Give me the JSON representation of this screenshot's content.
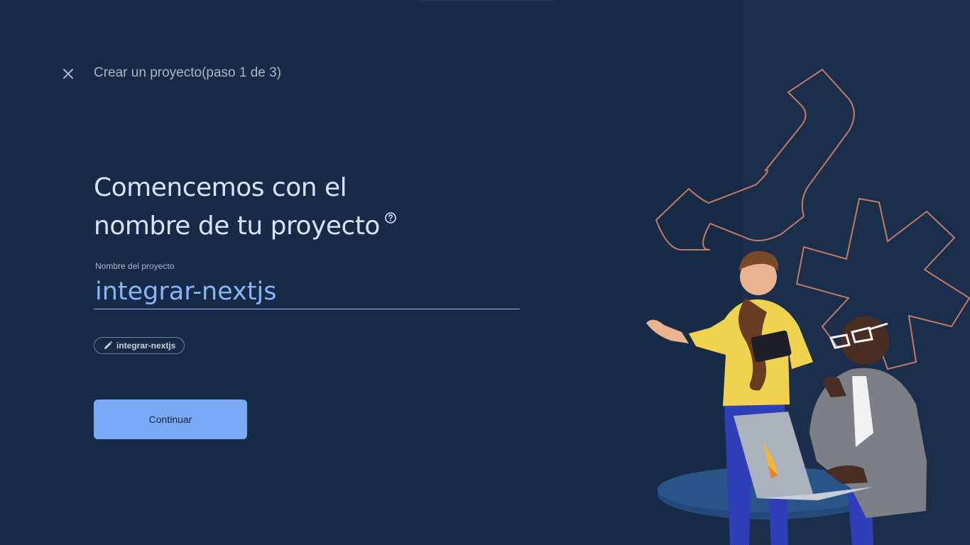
{
  "header": {
    "step_title": "Crear un proyecto(paso 1 de 3)",
    "close_icon": "close-icon"
  },
  "main": {
    "heading_line1": "Comencemos con el",
    "heading_line2": "nombre de tu proyecto",
    "help_icon": "help-circle-icon",
    "field_label": "Nombre del proyecto",
    "field_value": "integrar-nextjs",
    "project_id_chip": "integrar-nextjs",
    "chip_icon": "pencil-icon",
    "continue_label": "Continuar"
  },
  "colors": {
    "background": "#172a46",
    "accent": "#8ab4f8",
    "button": "#7aaaf6",
    "heading": "#d6e3fb",
    "decor_outline": "#c57a63"
  }
}
